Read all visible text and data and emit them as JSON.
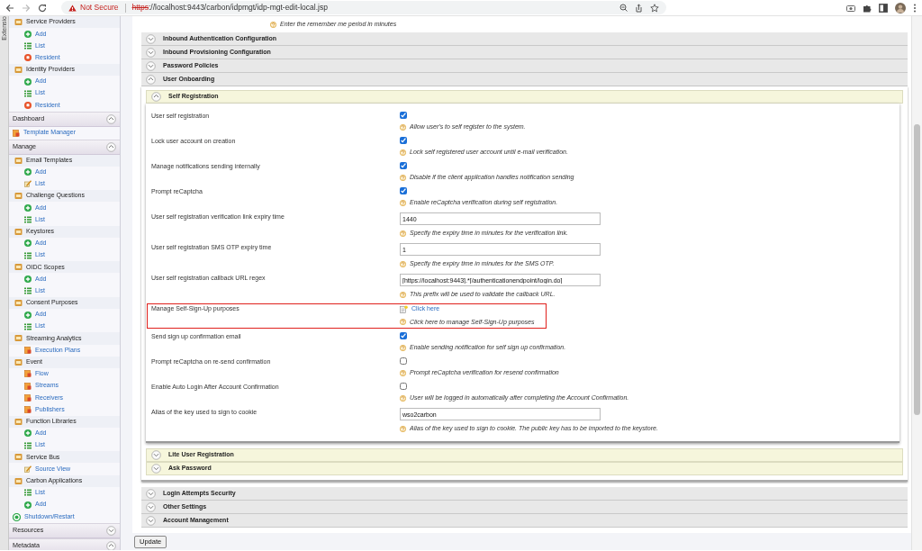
{
  "browser": {
    "security_label": "Not Secure",
    "url_scheme": "https",
    "url_rest": "://localhost:9443/carbon/idpmgt/idp-mgt-edit-local.jsp"
  },
  "extensions_tab": "Extensio",
  "sidebar": {
    "entries": [
      {
        "kind": "group",
        "label": "Service Providers",
        "children": [
          {
            "kind": "add",
            "label": "Add"
          },
          {
            "kind": "list",
            "label": "List"
          },
          {
            "kind": "resident",
            "label": "Resident"
          }
        ]
      },
      {
        "kind": "group",
        "label": "Identity Providers",
        "children": [
          {
            "kind": "add",
            "label": "Add"
          },
          {
            "kind": "list",
            "label": "List"
          },
          {
            "kind": "resident",
            "label": "Resident"
          }
        ]
      },
      {
        "kind": "section",
        "label": "Dashboard",
        "expanded": true
      },
      {
        "kind": "template_item",
        "label": "Template Manager"
      },
      {
        "kind": "section",
        "label": "Manage",
        "expanded": true
      },
      {
        "kind": "group",
        "label": "Email Templates",
        "children": [
          {
            "kind": "add",
            "label": "Add"
          },
          {
            "kind": "edit",
            "label": "List"
          }
        ]
      },
      {
        "kind": "group",
        "label": "Challenge Questions",
        "children": [
          {
            "kind": "add",
            "label": "Add"
          },
          {
            "kind": "list",
            "label": "List"
          }
        ]
      },
      {
        "kind": "group",
        "label": "Keystores",
        "children": [
          {
            "kind": "add",
            "label": "Add"
          },
          {
            "kind": "list",
            "label": "List"
          }
        ]
      },
      {
        "kind": "group",
        "label": "OIDC Scopes",
        "children": [
          {
            "kind": "add",
            "label": "Add"
          },
          {
            "kind": "list",
            "label": "List"
          }
        ]
      },
      {
        "kind": "group",
        "label": "Consent Purposes",
        "children": [
          {
            "kind": "add",
            "label": "Add"
          },
          {
            "kind": "list",
            "label": "List"
          }
        ]
      },
      {
        "kind": "group",
        "label": "Streaming Analytics",
        "children": [
          {
            "kind": "page",
            "label": "Execution Plans"
          }
        ]
      },
      {
        "kind": "group",
        "label": "Event",
        "children": [
          {
            "kind": "page",
            "label": "Flow"
          },
          {
            "kind": "page",
            "label": "Streams"
          },
          {
            "kind": "page",
            "label": "Receivers"
          },
          {
            "kind": "page",
            "label": "Publishers"
          }
        ]
      },
      {
        "kind": "group",
        "label": "Function Libraries",
        "children": [
          {
            "kind": "add",
            "label": "Add"
          },
          {
            "kind": "list",
            "label": "List"
          }
        ]
      },
      {
        "kind": "group",
        "label": "Service Bus",
        "children": [
          {
            "kind": "edit",
            "label": "Source View"
          }
        ]
      },
      {
        "kind": "group",
        "label": "Carbon Applications",
        "children": [
          {
            "kind": "list",
            "label": "List"
          },
          {
            "kind": "add",
            "label": "Add"
          }
        ]
      },
      {
        "kind": "shutdown_item",
        "label": "Shutdown/Restart"
      },
      {
        "kind": "section",
        "label": "Resources",
        "expanded": false
      },
      {
        "kind": "section",
        "label": "Metadata",
        "expanded": true
      }
    ]
  },
  "main": {
    "top_hint": "Enter the remember me period in minutes",
    "sections": [
      {
        "title": "Inbound Authentication Configuration",
        "expanded": false
      },
      {
        "title": "Inbound Provisioning Configuration",
        "expanded": false
      },
      {
        "title": "Password Policies",
        "expanded": false
      },
      {
        "title": "User Onboarding",
        "expanded": true,
        "subsections": [
          {
            "title": "Self Registration",
            "expanded": true,
            "fields": [
              {
                "kind": "checkbox",
                "label": "User self registration",
                "checked": true,
                "highlighted": false,
                "hint": "Allow user's to self register to the system."
              },
              {
                "kind": "checkbox",
                "label": "Lock user account on creation",
                "checked": true,
                "highlighted": false,
                "hint": "Lock self registered user account until e-mail verification."
              },
              {
                "kind": "checkbox",
                "label": "Manage notifications sending internally",
                "checked": true,
                "highlighted": false,
                "hint": "Disable if the client application handles notification sending"
              },
              {
                "kind": "checkbox",
                "label": "Prompt reCaptcha",
                "checked": true,
                "highlighted": false,
                "hint": "Enable reCaptcha verification during self registration."
              },
              {
                "kind": "text",
                "label": "User self registration verification link expiry time",
                "value": "1440",
                "highlighted": false,
                "hint": "Specify the expiry time in minutes for the verification link."
              },
              {
                "kind": "text",
                "label": "User self registration SMS OTP expiry time",
                "value": "1",
                "highlighted": false,
                "hint": "Specify the expiry time in minutes for the SMS OTP."
              },
              {
                "kind": "text",
                "label": "User self registration callback URL regex",
                "value": "[https://localhost:9443].*[/authenticationendpoint/login.do]",
                "highlighted": false,
                "hint": "This prefix will be used to validate the callback URL."
              },
              {
                "kind": "link",
                "label": "Manage Self-Sign-Up purposes",
                "link": "Click here",
                "highlighted": true,
                "hint": "Click here to manage Self-Sign-Up purposes"
              },
              {
                "kind": "checkbox",
                "label": "Send sign up confirmation email",
                "checked": true,
                "highlighted": false,
                "hint": "Enable sending notification for self sign up confirmation."
              },
              {
                "kind": "checkbox",
                "label": "Prompt reCaptcha on re-send confirmation",
                "checked": false,
                "highlighted": false,
                "hint": "Prompt reCaptcha verification for resend confirmation"
              },
              {
                "kind": "checkbox",
                "label": "Enable Auto Login After Account Confirmation",
                "checked": false,
                "highlighted": false,
                "hint": "User will be logged in automatically after completing the Account Confirmation."
              },
              {
                "kind": "text",
                "label": "Alias of the key used to sign to cookie",
                "value": "wso2carbon",
                "highlighted": false,
                "hint": "Alias of the key used to sign to cookie. The public key has to be imported to the keystore."
              }
            ]
          },
          {
            "title": "Lite User Registration",
            "expanded": false
          },
          {
            "title": "Ask Password",
            "expanded": false
          }
        ]
      },
      {
        "title": "Login Attempts Security",
        "expanded": false
      },
      {
        "title": "Other Settings",
        "expanded": false
      },
      {
        "title": "Account Management",
        "expanded": false
      }
    ],
    "update_button": "Update"
  }
}
